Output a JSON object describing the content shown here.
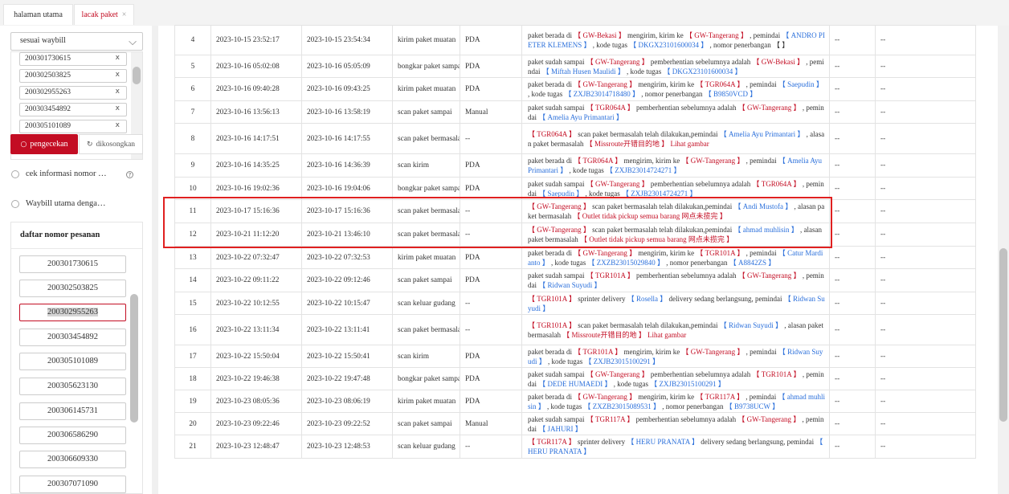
{
  "tabs": [
    {
      "label": "halaman utama",
      "active": false
    },
    {
      "label": "lacak paket",
      "active": true,
      "close": "×"
    }
  ],
  "sidebar": {
    "select_value": "sesuai waybill",
    "waybill_chips": [
      "200301730615",
      "200302503825",
      "200302955263",
      "200303454892",
      "200305101089"
    ],
    "chip_remove": "x",
    "search_button": "pengecekan",
    "clear_button": "dikosongkan",
    "option1": "cek informasi nomor …",
    "option2": "Waybill utama denga…",
    "order_title": "daftar nomor pesanan",
    "orders": [
      "200301730615",
      "200302503825",
      "200302955263",
      "200303454892",
      "200305101089",
      "200305623130",
      "200306145731",
      "200306586290",
      "200306609330",
      "200307071090"
    ],
    "active_order_index": 2
  },
  "table": {
    "rows": [
      {
        "no": "4",
        "t1": "2023-10-15 23:52:17",
        "t2": "2023-10-15 23:54:34",
        "type": "kirim paket muatan",
        "type_red": false,
        "device": "PDA",
        "desc": [
          [
            "paket berada di ",
            ""
          ],
          [
            "【 GW-Bekasi 】",
            "red"
          ],
          [
            " mengirim, kirim ke ",
            ""
          ],
          [
            "【 GW-Tangerang 】",
            "red"
          ],
          [
            " ,  pemindai ",
            ""
          ],
          [
            "【 ANDRO PIETER KLEMENS 】",
            "blue"
          ],
          [
            " ,  kode tugas ",
            ""
          ],
          [
            "【 DKGX23101600034 】",
            "blue"
          ],
          [
            " ,  nomor penerbangan 【 】",
            ""
          ]
        ],
        "f1": "--",
        "f2": "--"
      },
      {
        "no": "5",
        "t1": "2023-10-16 05:02:08",
        "t2": "2023-10-16 05:05:09",
        "type": "bongkar paket sampai",
        "type_red": false,
        "device": "PDA",
        "desc": [
          [
            "paket sudah sampai ",
            ""
          ],
          [
            "【 GW-Tangerang 】",
            "red"
          ],
          [
            " pemberhentian sebelumnya adalah ",
            ""
          ],
          [
            "【 GW-Bekasi 】",
            "red"
          ],
          [
            " ,  pemindai ",
            ""
          ],
          [
            "【 Miftah Husen Maulidi 】",
            "blue"
          ],
          [
            " ,  kode tugas ",
            ""
          ],
          [
            "【 DKGX23101600034 】",
            "blue"
          ]
        ],
        "f1": "--",
        "f2": "--"
      },
      {
        "no": "6",
        "t1": "2023-10-16 09:40:28",
        "t2": "2023-10-16 09:43:25",
        "type": "kirim paket muatan",
        "type_red": false,
        "device": "PDA",
        "desc": [
          [
            "paket berada di ",
            ""
          ],
          [
            "【 GW-Tangerang 】",
            "red"
          ],
          [
            " mengirim, kirim ke ",
            ""
          ],
          [
            "【 TGR064A 】",
            "red"
          ],
          [
            " ,  pemindai ",
            ""
          ],
          [
            "【 Saepudin 】",
            "blue"
          ],
          [
            " ,  kode tugas ",
            ""
          ],
          [
            "【 ZXJB23014718480 】",
            "blue"
          ],
          [
            " ,  nomor penerbangan ",
            ""
          ],
          [
            "【 B9850VCD 】",
            "blue"
          ]
        ],
        "f1": "--",
        "f2": "--"
      },
      {
        "no": "7",
        "t1": "2023-10-16 13:56:13",
        "t2": "2023-10-16 13:58:19",
        "type": "scan paket sampai",
        "type_red": false,
        "device": "Manual",
        "desc": [
          [
            "paket sudah sampai ",
            ""
          ],
          [
            "【 TGR064A 】",
            "red"
          ],
          [
            " pemberhentian sebelumnya adalah ",
            ""
          ],
          [
            "【 GW-Tangerang 】",
            "red"
          ],
          [
            " ,  pemindai ",
            ""
          ],
          [
            "【 Amelia Ayu Primantari 】",
            "blue"
          ]
        ],
        "f1": "--",
        "f2": "--"
      },
      {
        "no": "8",
        "t1": "2023-10-16 14:17:51",
        "t2": "2023-10-16 14:17:55",
        "type": "scan paket bermasalah",
        "type_red": true,
        "device": "--",
        "desc": [
          [
            "【 TGR064A 】",
            "red"
          ],
          [
            " scan paket bermasalah telah dilakukan,pemindai ",
            ""
          ],
          [
            "【 Amelia Ayu Primantari 】",
            "blue"
          ],
          [
            " ,  alasan paket bermasalah ",
            ""
          ],
          [
            "【 Missroute开错目的地 】",
            "red"
          ],
          [
            "  Lihat gambar",
            "red"
          ]
        ],
        "f1": "--",
        "f2": "--"
      },
      {
        "no": "9",
        "t1": "2023-10-16 14:35:25",
        "t2": "2023-10-16 14:36:39",
        "type": "scan kirim",
        "type_red": false,
        "device": "PDA",
        "desc": [
          [
            "paket berada di ",
            ""
          ],
          [
            "【 TGR064A 】",
            "red"
          ],
          [
            " mengirim, kirim ke ",
            ""
          ],
          [
            "【 GW-Tangerang 】",
            "red"
          ],
          [
            " ,  pemindai ",
            ""
          ],
          [
            "【 Amelia Ayu Primantari 】",
            "blue"
          ],
          [
            " ,  kode tugas ",
            ""
          ],
          [
            "【 ZXJB23014724271 】",
            "blue"
          ]
        ],
        "f1": "--",
        "f2": "--"
      },
      {
        "no": "10",
        "t1": "2023-10-16 19:02:36",
        "t2": "2023-10-16 19:04:06",
        "type": "bongkar paket sampai",
        "type_red": false,
        "device": "PDA",
        "desc": [
          [
            "paket sudah sampai ",
            ""
          ],
          [
            "【 GW-Tangerang 】",
            "red"
          ],
          [
            " pemberhentian sebelumnya adalah ",
            ""
          ],
          [
            "【 TGR064A 】",
            "red"
          ],
          [
            " ,  pemindai ",
            ""
          ],
          [
            "【 Saepudin 】",
            "blue"
          ],
          [
            " ,  kode tugas ",
            ""
          ],
          [
            "【 ZXJB23014724271 】",
            "blue"
          ]
        ],
        "f1": "--",
        "f2": "--"
      },
      {
        "no": "11",
        "t1": "2023-10-17 15:16:36",
        "t2": "2023-10-17 15:16:36",
        "type": "scan paket bermasalah",
        "type_red": true,
        "device": "--",
        "desc": [
          [
            "【 GW-Tangerang 】",
            "red"
          ],
          [
            " scan paket bermasalah telah dilakukan,pemindai ",
            ""
          ],
          [
            "【 Andi Mustofa 】",
            "blue"
          ],
          [
            " ,  alasan paket bermasalah ",
            ""
          ],
          [
            "【 Outlet tidak pickup semua barang 网点未揽完 】",
            "red"
          ]
        ],
        "f1": "--",
        "f2": "--"
      },
      {
        "no": "12",
        "t1": "2023-10-21 11:12:20",
        "t2": "2023-10-21 13:46:10",
        "type": "scan paket bermasalah",
        "type_red": true,
        "device": "--",
        "desc": [
          [
            "【 GW-Tangerang 】",
            "red"
          ],
          [
            " scan paket bermasalah telah dilakukan,pemindai ",
            ""
          ],
          [
            "【 ahmad muhlisin 】",
            "blue"
          ],
          [
            " ,  alasan paket bermasalah ",
            ""
          ],
          [
            "【 Outlet tidak pickup semua barang 网点未揽完 】",
            "red"
          ]
        ],
        "f1": "--",
        "f2": "--"
      },
      {
        "no": "13",
        "t1": "2023-10-22 07:32:47",
        "t2": "2023-10-22 07:32:53",
        "type": "kirim paket muatan",
        "type_red": false,
        "device": "PDA",
        "desc": [
          [
            "paket berada di ",
            ""
          ],
          [
            "【 GW-Tangerang 】",
            "red"
          ],
          [
            " mengirim, kirim ke ",
            ""
          ],
          [
            "【 TGR101A 】",
            "red"
          ],
          [
            " ,  pemindai ",
            ""
          ],
          [
            "【 Catur Mardianto 】",
            "blue"
          ],
          [
            " ,  kode tugas ",
            ""
          ],
          [
            "【 ZXZB23015029840 】",
            "blue"
          ],
          [
            " ,  nomor penerbangan ",
            ""
          ],
          [
            "【 A8842ZS 】",
            "blue"
          ]
        ],
        "f1": "--",
        "f2": "--"
      },
      {
        "no": "14",
        "t1": "2023-10-22 09:11:22",
        "t2": "2023-10-22 09:12:46",
        "type": "scan paket sampai",
        "type_red": false,
        "device": "PDA",
        "desc": [
          [
            "paket sudah sampai ",
            ""
          ],
          [
            "【 TGR101A 】",
            "red"
          ],
          [
            " pemberhentian sebelumnya adalah ",
            ""
          ],
          [
            "【 GW-Tangerang 】",
            "red"
          ],
          [
            " ,  pemindai ",
            ""
          ],
          [
            "【 Ridwan Suyudi 】",
            "blue"
          ]
        ],
        "f1": "--",
        "f2": "--"
      },
      {
        "no": "15",
        "t1": "2023-10-22 10:12:55",
        "t2": "2023-10-22 10:15:47",
        "type": "scan keluar gudang",
        "type_red": false,
        "device": "--",
        "desc": [
          [
            "【 TGR101A 】",
            "red"
          ],
          [
            " sprinter delivery ",
            ""
          ],
          [
            "【 Rosella 】",
            "blue"
          ],
          [
            " delivery sedang berlangsung, pemindai ",
            ""
          ],
          [
            "【 Ridwan Suyudi 】",
            "blue"
          ]
        ],
        "f1": "--",
        "f2": "--"
      },
      {
        "no": "16",
        "t1": "2023-10-22 13:11:34",
        "t2": "2023-10-22 13:11:41",
        "type": "scan paket bermasalah",
        "type_red": true,
        "device": "--",
        "desc": [
          [
            "【 TGR101A 】",
            "red"
          ],
          [
            " scan paket bermasalah telah dilakukan,pemindai ",
            ""
          ],
          [
            "【 Ridwan Suyudi 】",
            "blue"
          ],
          [
            " ,  alasan paket bermasalah ",
            ""
          ],
          [
            "【 Missroute开错目的地 】",
            "red"
          ],
          [
            "  Lihat gambar",
            "red"
          ]
        ],
        "f1": "--",
        "f2": "--"
      },
      {
        "no": "17",
        "t1": "2023-10-22 15:50:04",
        "t2": "2023-10-22 15:50:41",
        "type": "scan kirim",
        "type_red": false,
        "device": "PDA",
        "desc": [
          [
            "paket berada di ",
            ""
          ],
          [
            "【 TGR101A 】",
            "red"
          ],
          [
            " mengirim, kirim ke ",
            ""
          ],
          [
            "【 GW-Tangerang 】",
            "red"
          ],
          [
            " ,  pemindai ",
            ""
          ],
          [
            "【 Ridwan Suyudi 】",
            "blue"
          ],
          [
            " ,  kode tugas ",
            ""
          ],
          [
            "【 ZXJB23015100291 】",
            "blue"
          ]
        ],
        "f1": "--",
        "f2": "--"
      },
      {
        "no": "18",
        "t1": "2023-10-22 19:46:38",
        "t2": "2023-10-22 19:47:48",
        "type": "bongkar paket sampai",
        "type_red": false,
        "device": "PDA",
        "desc": [
          [
            "paket sudah sampai ",
            ""
          ],
          [
            "【 GW-Tangerang 】",
            "red"
          ],
          [
            " pemberhentian sebelumnya adalah ",
            ""
          ],
          [
            "【 TGR101A 】",
            "red"
          ],
          [
            " ,  pemindai ",
            ""
          ],
          [
            "【 DEDE HUMAEDI 】",
            "blue"
          ],
          [
            " ,  kode tugas ",
            ""
          ],
          [
            "【 ZXJB23015100291 】",
            "blue"
          ]
        ],
        "f1": "--",
        "f2": "--"
      },
      {
        "no": "19",
        "t1": "2023-10-23 08:05:36",
        "t2": "2023-10-23 08:06:19",
        "type": "kirim paket muatan",
        "type_red": false,
        "device": "PDA",
        "desc": [
          [
            "paket berada di ",
            ""
          ],
          [
            "【 GW-Tangerang 】",
            "red"
          ],
          [
            " mengirim, kirim ke ",
            ""
          ],
          [
            "【 TGR117A 】",
            "red"
          ],
          [
            " ,  pemindai ",
            ""
          ],
          [
            "【 ahmad muhlisin 】",
            "blue"
          ],
          [
            " ,  kode tugas ",
            ""
          ],
          [
            "【 ZXZB23015089531 】",
            "blue"
          ],
          [
            " ,  nomor penerbangan ",
            ""
          ],
          [
            "【 B9738UCW 】",
            "blue"
          ]
        ],
        "f1": "--",
        "f2": "--"
      },
      {
        "no": "20",
        "t1": "2023-10-23 09:22:46",
        "t2": "2023-10-23 09:22:52",
        "type": "scan paket sampai",
        "type_red": false,
        "device": "Manual",
        "desc": [
          [
            "paket sudah sampai ",
            ""
          ],
          [
            "【 TGR117A 】",
            "red"
          ],
          [
            " pemberhentian sebelumnya adalah ",
            ""
          ],
          [
            "【 GW-Tangerang 】",
            "red"
          ],
          [
            " ,  pemindai ",
            ""
          ],
          [
            "【 JAHURI 】",
            "blue"
          ]
        ],
        "f1": "--",
        "f2": "--"
      },
      {
        "no": "21",
        "t1": "2023-10-23 12:48:47",
        "t2": "2023-10-23 12:48:53",
        "type": "scan keluar gudang",
        "type_red": false,
        "device": "--",
        "desc": [
          [
            "【 TGR117A 】",
            "red"
          ],
          [
            " sprinter delivery ",
            ""
          ],
          [
            "【 HERU PRANATA 】",
            "blue"
          ],
          [
            " delivery sedang berlangsung, pemindai ",
            ""
          ],
          [
            "【 HERU PRANATA 】",
            "blue"
          ]
        ],
        "f1": "--",
        "f2": "--"
      }
    ]
  },
  "colors": {
    "accent": "#c30d23",
    "link_blue": "#2a6fdb",
    "highlight_border": "#e02020"
  }
}
